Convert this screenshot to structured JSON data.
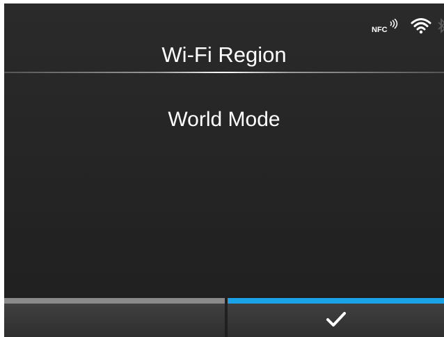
{
  "status": {
    "nfc_label": "NFC",
    "icons": [
      "nfc-icon",
      "wifi-icon",
      "bluetooth-icon"
    ]
  },
  "screen": {
    "title": "Wi-Fi Region",
    "value": "World Mode"
  },
  "softkeys": {
    "left": {
      "label": "",
      "bar_color": "#8a8a8a"
    },
    "right": {
      "icon": "checkmark-icon",
      "bar_color": "#1aa3e8"
    }
  },
  "colors": {
    "background": "#262626",
    "text": "#ffffff",
    "accent": "#1aa3e8"
  }
}
